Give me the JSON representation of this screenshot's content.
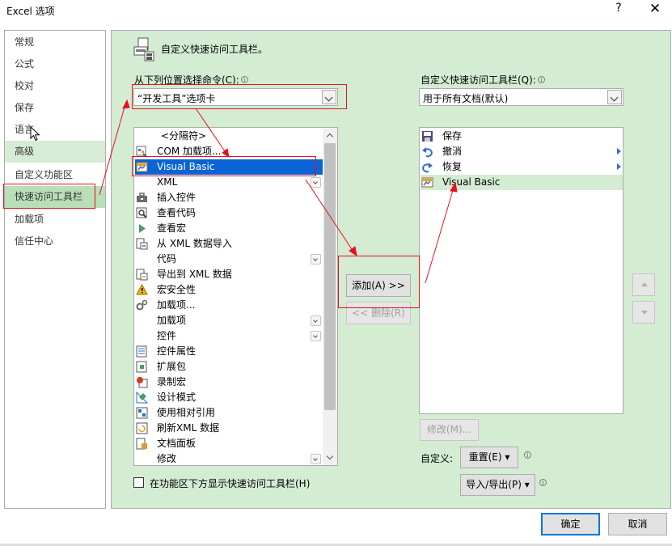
{
  "window": {
    "title": "Excel 选项",
    "help": "?",
    "close": "✕"
  },
  "nav": {
    "items": [
      "常规",
      "公式",
      "校对",
      "保存",
      "语言",
      "高级",
      "自定义功能区",
      "快速访问工具栏",
      "加载项",
      "信任中心"
    ],
    "selected": "快速访问工具栏"
  },
  "header": {
    "title": "自定义快速访问工具栏。"
  },
  "left": {
    "label": "从下列位置选择命令(C):",
    "combo_value": "“开发工具”选项卡",
    "commands": [
      {
        "label": "<分隔符>",
        "icon": "none"
      },
      {
        "label": "COM 加载项...",
        "icon": "com-addin-icon"
      },
      {
        "label": "Visual Basic",
        "icon": "visual-basic-icon"
      },
      {
        "label": "XML",
        "icon": "none"
      },
      {
        "label": "插入控件",
        "icon": "toolbox-icon"
      },
      {
        "label": "查看代码",
        "icon": "view-code-icon"
      },
      {
        "label": "查看宏",
        "icon": "play-icon"
      },
      {
        "label": "从 XML 数据导入",
        "icon": "xml-import-icon"
      },
      {
        "label": "代码",
        "icon": "none"
      },
      {
        "label": "导出到 XML 数据",
        "icon": "xml-export-icon"
      },
      {
        "label": "宏安全性",
        "icon": "warning-icon"
      },
      {
        "label": "加载项...",
        "icon": "gears-icon"
      },
      {
        "label": "加载项",
        "icon": "none"
      },
      {
        "label": "控件",
        "icon": "none"
      },
      {
        "label": "控件属性",
        "icon": "properties-icon"
      },
      {
        "label": "扩展包",
        "icon": "package-icon"
      },
      {
        "label": "录制宏",
        "icon": "record-icon"
      },
      {
        "label": "设计模式",
        "icon": "design-mode-icon"
      },
      {
        "label": "使用相对引用",
        "icon": "relative-ref-icon"
      },
      {
        "label": "刷新XML 数据",
        "icon": "refresh-xml-icon"
      },
      {
        "label": "文档面板",
        "icon": "document-panel-icon"
      },
      {
        "label": "修改",
        "icon": "none"
      }
    ]
  },
  "right": {
    "label": "自定义快速访问工具栏(Q):",
    "combo_value": "用于所有文档(默认)",
    "items": [
      {
        "label": "保存",
        "icon": "save-icon"
      },
      {
        "label": "撤消",
        "icon": "undo-icon"
      },
      {
        "label": "恢复",
        "icon": "redo-icon"
      },
      {
        "label": "Visual Basic",
        "icon": "visual-basic-icon"
      }
    ]
  },
  "buttons": {
    "add": "添加(A) >>",
    "remove": "<< 删除(R)",
    "modify": "修改(M)...",
    "customize_label": "自定义:",
    "reset": "重置(E) ▾",
    "import_export": "导入/导出(P) ▾",
    "ok": "确定",
    "cancel": "取消"
  },
  "checkbox": {
    "label": "在功能区下方显示快速访问工具栏(H)",
    "checked": false
  },
  "colors": {
    "panel_bg": "#d3ecd2",
    "selection": "#0a64d6",
    "annotation": "#e81123"
  }
}
